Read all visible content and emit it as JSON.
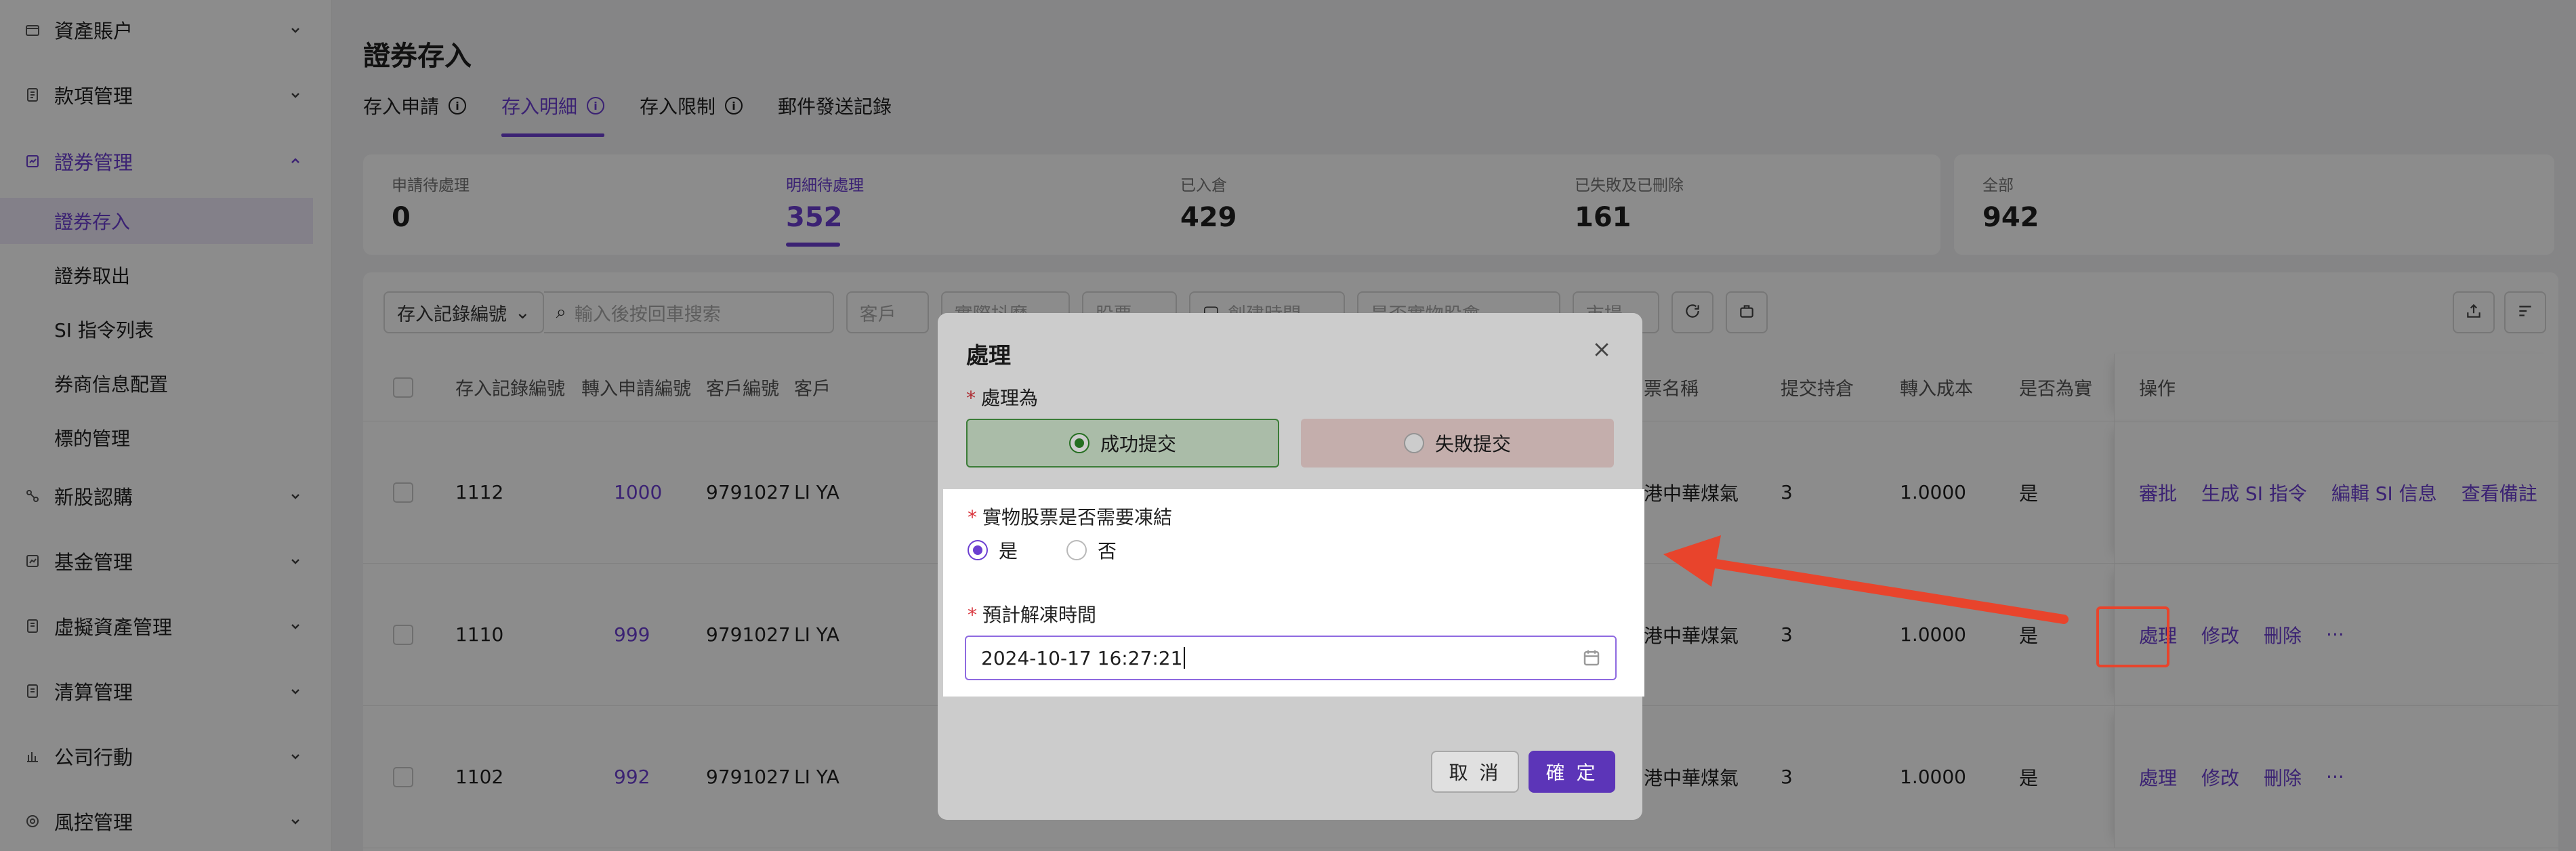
{
  "sidebar": {
    "items": [
      {
        "label": "資產賬户",
        "icon": "wallet-icon"
      },
      {
        "label": "款項管理",
        "icon": "ledger-icon"
      },
      {
        "label": "證券管理",
        "icon": "securities-icon"
      },
      {
        "label": "新股認購",
        "icon": "ipo-icon"
      },
      {
        "label": "基金管理",
        "icon": "fund-icon"
      },
      {
        "label": "虛擬資產管理",
        "icon": "crypto-icon"
      },
      {
        "label": "清算管理",
        "icon": "clearing-icon"
      },
      {
        "label": "公司行動",
        "icon": "corporate-action-icon"
      },
      {
        "label": "風控管理",
        "icon": "risk-icon"
      }
    ],
    "sub_items": [
      "證券存入",
      "證券取出",
      "SI 指令列表",
      "券商信息配置",
      "標的管理"
    ]
  },
  "page": {
    "title": "證券存入",
    "tabs": [
      "存入申請",
      "存入明細",
      "存入限制",
      "郵件發送記錄"
    ]
  },
  "stats": [
    {
      "label": "申請待處理",
      "value": "0"
    },
    {
      "label": "明細待處理",
      "value": "352"
    },
    {
      "label": "已入倉",
      "value": "429"
    },
    {
      "label": "已失敗及已刪除",
      "value": "161"
    },
    {
      "label": "全部",
      "value": "942"
    }
  ],
  "filters": {
    "record_select": "存入記錄編號",
    "search_placeholder": "輸入後按回車搜索",
    "customer": "客戶",
    "f3": "實際抖摩",
    "f4": "股票",
    "created_time": "創建時間",
    "f6": "是否實物股會",
    "market": "市場"
  },
  "table": {
    "headers": [
      "存入記錄編號",
      "轉入申請編號",
      "客戶編號",
      "客戶",
      "票名稱",
      "提交持倉",
      "轉入成本",
      "是否為實",
      "操作"
    ],
    "rows": [
      {
        "record": "1112",
        "apply": "1000",
        "cust_no": "9791027",
        "cust": "LI YA",
        "stock": "港中華煤氣",
        "qty": "3",
        "cost": "1.0000",
        "physical": "是",
        "ops": [
          "審批",
          "生成 SI 指令",
          "編輯 SI 信息",
          "查看備註"
        ]
      },
      {
        "record": "1110",
        "apply": "999",
        "cust_no": "9791027",
        "cust": "LI YA",
        "stock": "港中華煤氣",
        "qty": "3",
        "cost": "1.0000",
        "physical": "是",
        "ops": [
          "處理",
          "修改",
          "刪除",
          "···"
        ]
      },
      {
        "record": "1102",
        "apply": "992",
        "cust_no": "9791027",
        "cust": "LI YA",
        "stock": "港中華煤氣",
        "qty": "3",
        "cost": "1.0000",
        "physical": "是",
        "ops": [
          "處理",
          "修改",
          "刪除",
          "···"
        ]
      }
    ]
  },
  "modal": {
    "title": "處理",
    "process_label": "處理為",
    "success_label": "成功提交",
    "fail_label": "失敗提交",
    "freeze_label": "實物股票是否需要凍結",
    "yes": "是",
    "no": "否",
    "unfreeze_label": "預計解凍時間",
    "unfreeze_value": "2024-10-17 16:27:21",
    "cancel": "取 消",
    "confirm": "確 定"
  },
  "colors": {
    "accent": "#6c3fd1",
    "annotation": "#e8442c",
    "success_bg": "#d5ecd3",
    "fail_bg": "#f6dad8"
  }
}
